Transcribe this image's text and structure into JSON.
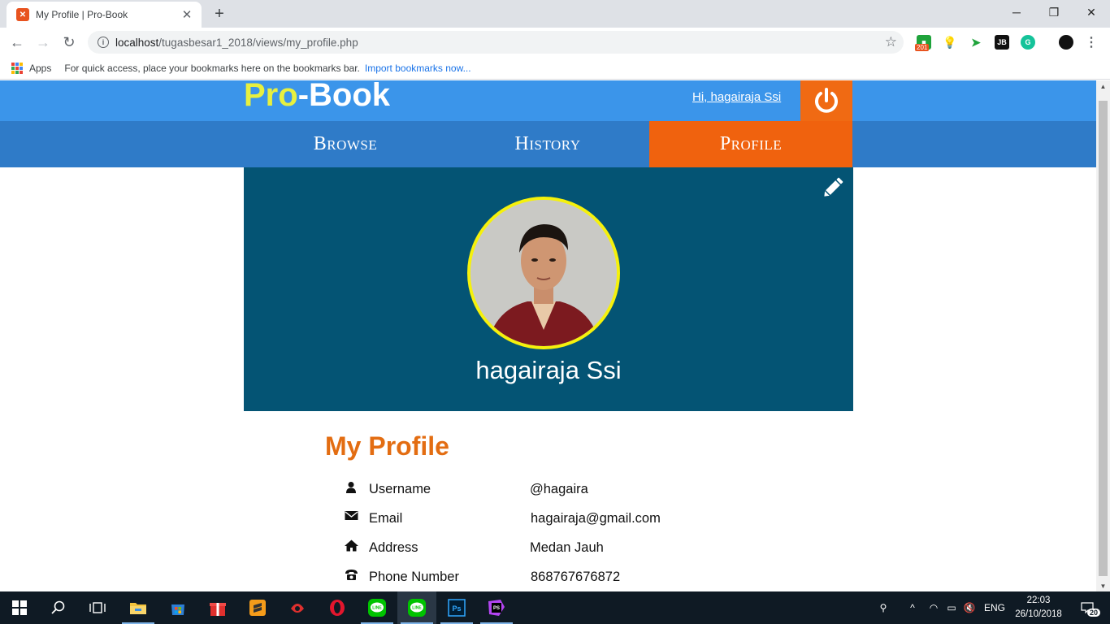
{
  "browser": {
    "tab_title": "My Profile | Pro-Book",
    "url_host": "localhost",
    "url_path": "/tugasbesar1_2018/views/my_profile.php",
    "extension_badge": "201",
    "bookmarks_apps": "Apps",
    "bookmarks_hint": "For quick access, place your bookmarks here on the bookmarks bar.",
    "bookmarks_import": "Import bookmarks now..."
  },
  "header": {
    "logo_pro": "Pro",
    "logo_book": "-Book",
    "greeting": "Hi, hagairaja Ssi",
    "colors": {
      "header": "#3b95ea",
      "nav": "#2f7bc8",
      "accent": "#f0620e",
      "logo_pro": "#e7f03f"
    }
  },
  "nav": {
    "tabs": [
      {
        "label": "Browse"
      },
      {
        "label": "History"
      },
      {
        "label": "Profile",
        "active": true
      }
    ]
  },
  "profile": {
    "full_name": "hagairaja Ssi",
    "card_color": "#045474",
    "avatar_border": "#f5f10c"
  },
  "my_profile": {
    "title": "My Profile",
    "rows": [
      {
        "icon": "user-icon",
        "label": "Username",
        "value": "@hagaira"
      },
      {
        "icon": "envelope-icon",
        "label": "Email",
        "value": "hagairaja@gmail.com"
      },
      {
        "icon": "home-icon",
        "label": "Address",
        "value": "Medan Jauh"
      },
      {
        "icon": "phone-icon",
        "label": "Phone Number",
        "value": "868767676872"
      }
    ]
  },
  "taskbar": {
    "language": "ENG",
    "time": "22:03",
    "date": "26/10/2018",
    "notification_count": "20"
  }
}
